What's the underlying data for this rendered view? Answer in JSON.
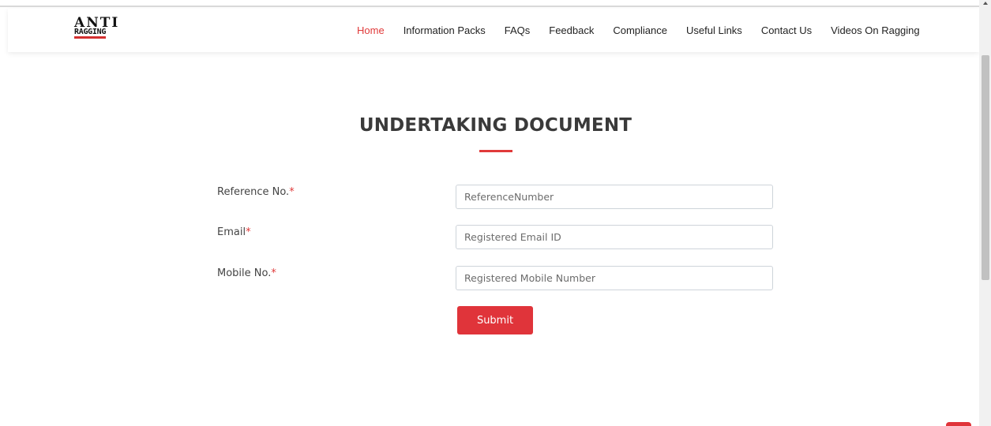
{
  "brand": {
    "line1": "ANTI",
    "line2": "RAGGING"
  },
  "nav": {
    "items": [
      {
        "label": "Home",
        "active": true
      },
      {
        "label": "Information Packs",
        "active": false
      },
      {
        "label": "FAQs",
        "active": false
      },
      {
        "label": "Feedback",
        "active": false
      },
      {
        "label": "Compliance",
        "active": false
      },
      {
        "label": "Useful Links",
        "active": false
      },
      {
        "label": "Contact Us",
        "active": false
      },
      {
        "label": "Videos On Ragging",
        "active": false
      }
    ]
  },
  "page": {
    "title": "UNDERTAKING DOCUMENT"
  },
  "form": {
    "reference": {
      "label": "Reference No.",
      "required_mark": "*",
      "placeholder": "ReferenceNumber",
      "value": ""
    },
    "email": {
      "label": "Email",
      "required_mark": "*",
      "placeholder": "Registered Email ID",
      "value": ""
    },
    "mobile": {
      "label": "Mobile No.",
      "required_mark": "*",
      "placeholder": "Registered Mobile Number",
      "value": ""
    },
    "submit_label": "Submit"
  },
  "colors": {
    "accent": "#e03a3a",
    "text": "#3a3a3a"
  },
  "icons": {
    "back_to_top": "chevron-up-icon"
  }
}
